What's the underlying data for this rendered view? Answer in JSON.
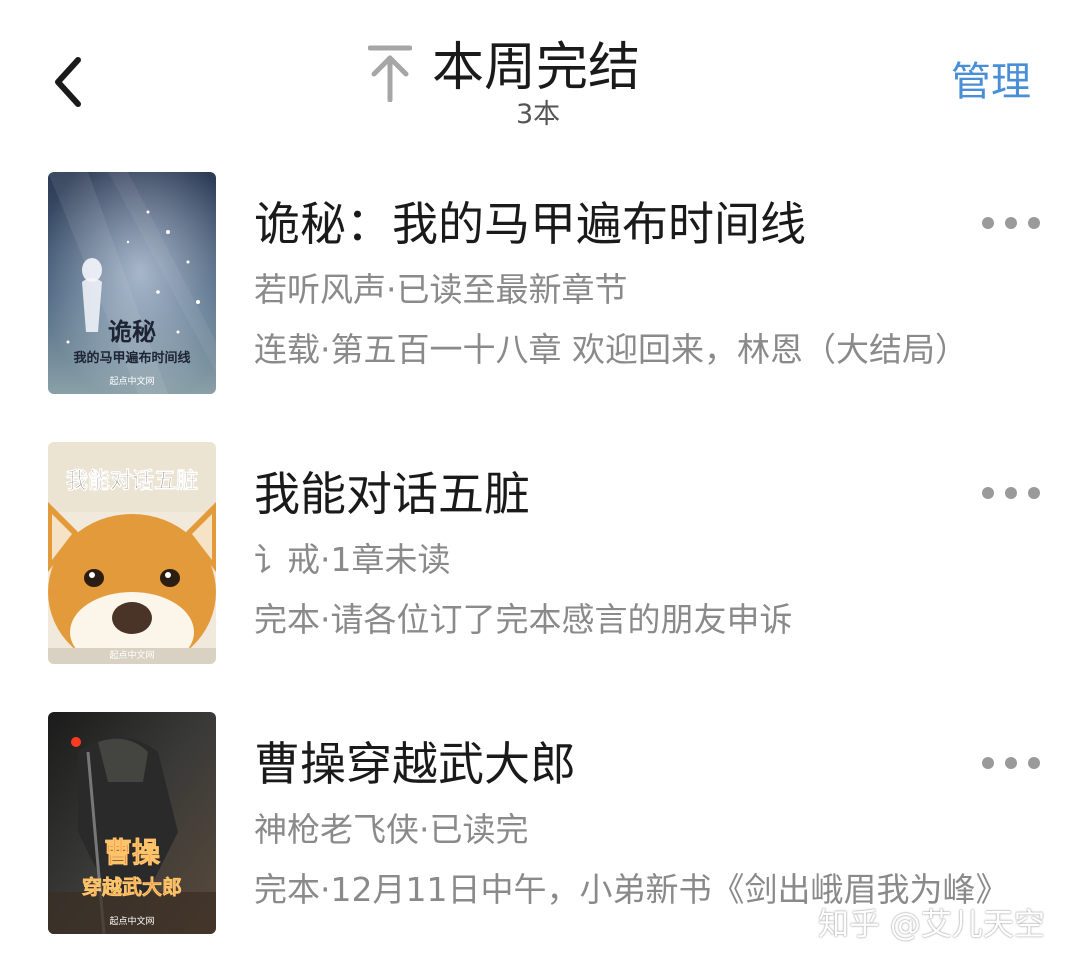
{
  "header": {
    "back_icon": "chevron-left-icon",
    "pin_icon": "pin-to-top-icon",
    "title": "本周完结",
    "count": "3本",
    "manage_label": "管理",
    "manage_color": "#4a8fd6"
  },
  "books": [
    {
      "title": "诡秘：我的马甲遍布时间线",
      "meta": "若听风声·已读至最新章节",
      "update": "连载·第五百一十八章 欢迎回来，林恩（大结局）",
      "cover_title_line1": "诡秘",
      "cover_title_line2": "我的马甲遍布时间线",
      "cover_publisher": "起点中文网"
    },
    {
      "title": "我能对话五脏",
      "meta": "讠戒·1章未读",
      "update": "完本·请各位订了完本感言的朋友申诉",
      "cover_title_line1": "我能对话五脏",
      "cover_publisher": "起点中文网"
    },
    {
      "title": "曹操穿越武大郎",
      "meta": "神枪老飞侠·已读完",
      "update": "完本·12月11日中午，小弟新书《剑出峨眉我为峰》",
      "cover_title_line1": "曹操",
      "cover_title_line2": "穿越武大郎",
      "cover_publisher": "起点中文网"
    }
  ],
  "more_icon": "more-dots-icon",
  "watermark": "知乎 @艾儿天空"
}
